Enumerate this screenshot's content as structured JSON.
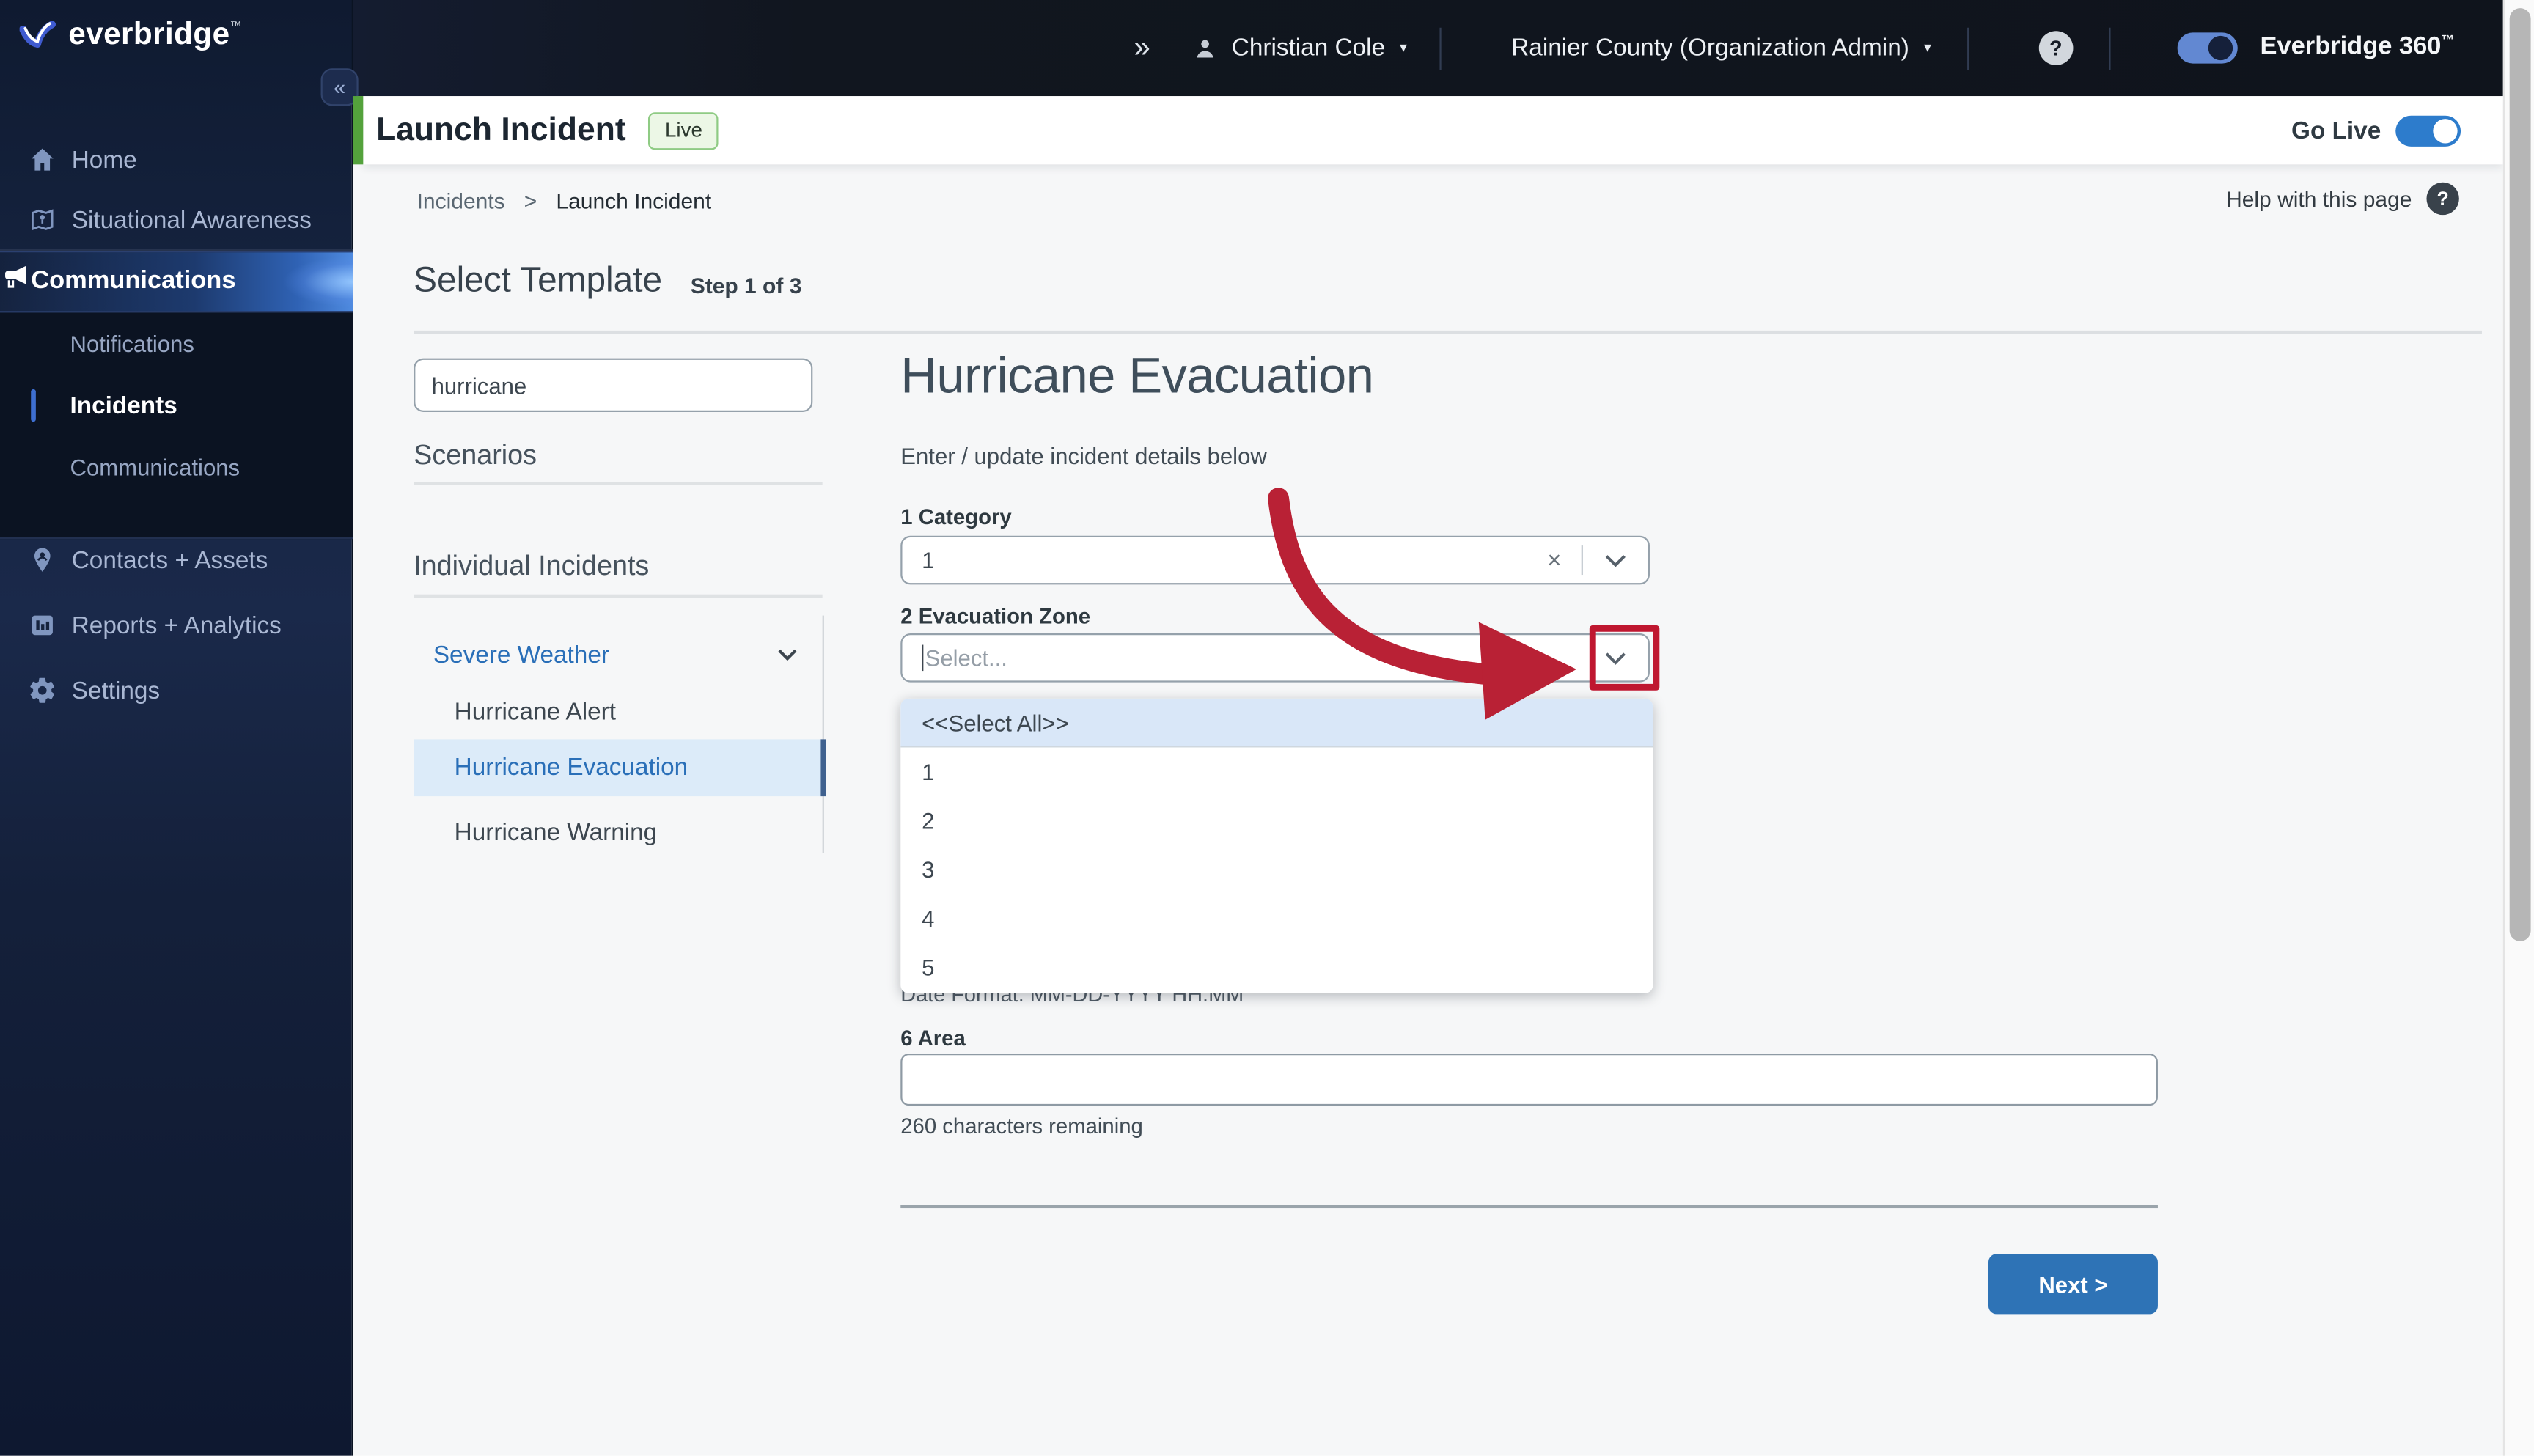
{
  "brand": {
    "logo_text": "everbridge",
    "tm": "™"
  },
  "topbar": {
    "expand_icon": "»",
    "user_name": "Christian Cole",
    "caret": "▾",
    "org_name": "Rainier County (Organization Admin)",
    "help_q": "?",
    "product_name": "Everbridge 360",
    "product_tm": "™"
  },
  "sidebar": {
    "collapse_icon": "«",
    "items": [
      {
        "label": "Home"
      },
      {
        "label": "Situational Awareness"
      },
      {
        "label": "Communications"
      }
    ],
    "sub_items": [
      {
        "label": "Notifications"
      },
      {
        "label": "Incidents"
      },
      {
        "label": "Communications"
      }
    ],
    "lower_items": [
      {
        "label": "Contacts + Assets"
      },
      {
        "label": "Reports + Analytics"
      },
      {
        "label": "Settings"
      }
    ]
  },
  "header": {
    "title": "Launch Incident",
    "badge": "Live",
    "go_live_label": "Go Live"
  },
  "breadcrumb": {
    "parent": "Incidents",
    "separator": ">",
    "current": "Launch Incident",
    "help_label": "Help with this page",
    "help_q": "?"
  },
  "browser": {
    "title": "Select Template",
    "step": "Step 1 of 3",
    "search_value": "hurricane",
    "scenarios_heading": "Scenarios",
    "individual_heading": "Individual Incidents",
    "group_label": "Severe Weather",
    "items": [
      {
        "label": "Hurricane Alert"
      },
      {
        "label": "Hurricane Evacuation"
      },
      {
        "label": "Hurricane Warning"
      }
    ]
  },
  "form": {
    "title": "Hurricane Evacuation",
    "subtitle": "Enter / update incident details below",
    "category_label": "1 Category",
    "category_value": "1",
    "clear_icon": "×",
    "zone_label": "2 Evacuation Zone",
    "zone_placeholder": "Select...",
    "dropdown_options": [
      {
        "label": "<<Select All>>"
      },
      {
        "label": "1"
      },
      {
        "label": "2"
      },
      {
        "label": "3"
      },
      {
        "label": "4"
      },
      {
        "label": "5"
      }
    ],
    "date_format_hint": "Date Format: MM-DD-YYYY HH:MM",
    "area_label": "6 Area",
    "chars_hint": "260 characters remaining",
    "next_label": "Next >"
  },
  "colors": {
    "accent_green": "#54a23c",
    "annotation_red": "#bf1730",
    "primary_blue": "#2e73b6",
    "selection_blue": "#dcebf9"
  }
}
